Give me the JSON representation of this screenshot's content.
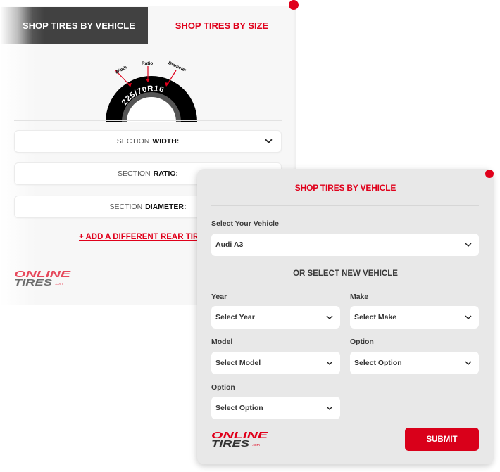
{
  "size_panel": {
    "tabs": {
      "vehicle": "SHOP TIRES BY VEHICLE",
      "size": "SHOP TIRES BY SIZE"
    },
    "diagram": {
      "size_code": "225/70R16",
      "labels": [
        "Width",
        "Ratio",
        "Diameter"
      ]
    },
    "selects": [
      {
        "prefix": "SECTION",
        "label": "WIDTH:"
      },
      {
        "prefix": "SECTION",
        "label": "RATIO:"
      },
      {
        "prefix": "SECTION",
        "label": "DIAMETER:"
      }
    ],
    "add_rear_link": "+ ADD A DIFFERENT REAR TIRE",
    "logo": {
      "line1": "ONLINE",
      "line2": "TIRES",
      "suffix": ".com"
    }
  },
  "vehicle_modal": {
    "title": "SHOP TIRES BY VEHICLE",
    "select_vehicle_label": "Select Your Vehicle",
    "select_vehicle_value": "Audi A3",
    "or_new_vehicle": "OR SELECT NEW VEHICLE",
    "fields": {
      "year": {
        "label": "Year",
        "value": "Select Year"
      },
      "make": {
        "label": "Make",
        "value": "Select Make"
      },
      "model": {
        "label": "Model",
        "value": "Select Model"
      },
      "option1": {
        "label": "Option",
        "value": "Select Option"
      },
      "option2": {
        "label": "Option",
        "value": "Select Option"
      }
    },
    "submit_label": "SUBMIT",
    "logo": {
      "line1": "ONLINE",
      "line2": "TIRES",
      "suffix": ".com"
    }
  },
  "colors": {
    "brand_red": "#e0001b",
    "tab_dark": "#414141",
    "modal_bg": "#e8e8e8"
  }
}
